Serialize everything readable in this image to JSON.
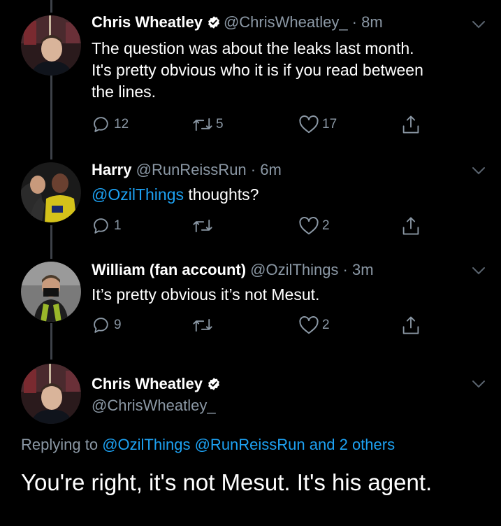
{
  "theme": {
    "background": "#000000",
    "text": "#ffffff",
    "muted": "#8b98a5",
    "link": "#1da1f2",
    "thread_line": "#3d4148",
    "verified": "#ffffff"
  },
  "tweets": [
    {
      "name": "Chris Wheatley",
      "verified": true,
      "handle": "@ChrisWheatley_",
      "time": "8m",
      "text_lines": [
        "The question was about the leaks last month.",
        "It's pretty obvious who it is if you read between",
        "the lines."
      ],
      "replies": "12",
      "retweets": "5",
      "likes": "17",
      "avatar_icon": "profile-photo"
    },
    {
      "name": "Harry",
      "verified": false,
      "handle": "@RunReissRun",
      "time": "6m",
      "mention": "@OzilThings",
      "text_after_mention": " thoughts?",
      "replies": "1",
      "retweets": "",
      "likes": "2",
      "avatar_icon": "profile-photo"
    },
    {
      "name": "William (fan account)",
      "verified": false,
      "handle": "@OzilThings",
      "time": "3m",
      "text": "It’s pretty obvious it’s not Mesut.",
      "replies": "9",
      "retweets": "",
      "likes": "2",
      "avatar_icon": "profile-photo"
    }
  ],
  "main_tweet": {
    "name": "Chris Wheatley",
    "verified": true,
    "handle": "@ChrisWheatley_",
    "replying_prefix": "Replying to",
    "replying_to": [
      "@OzilThings",
      "@RunReissRun"
    ],
    "replying_suffix": "and 2 others",
    "text": "You're right, it's not Mesut. It's his agent."
  },
  "separator_dot": "·",
  "icons": {
    "reply": "reply-icon",
    "retweet": "retweet-icon",
    "like": "heart-icon",
    "share": "share-icon",
    "more": "chevron-down-icon",
    "verified": "verified-badge-icon"
  }
}
